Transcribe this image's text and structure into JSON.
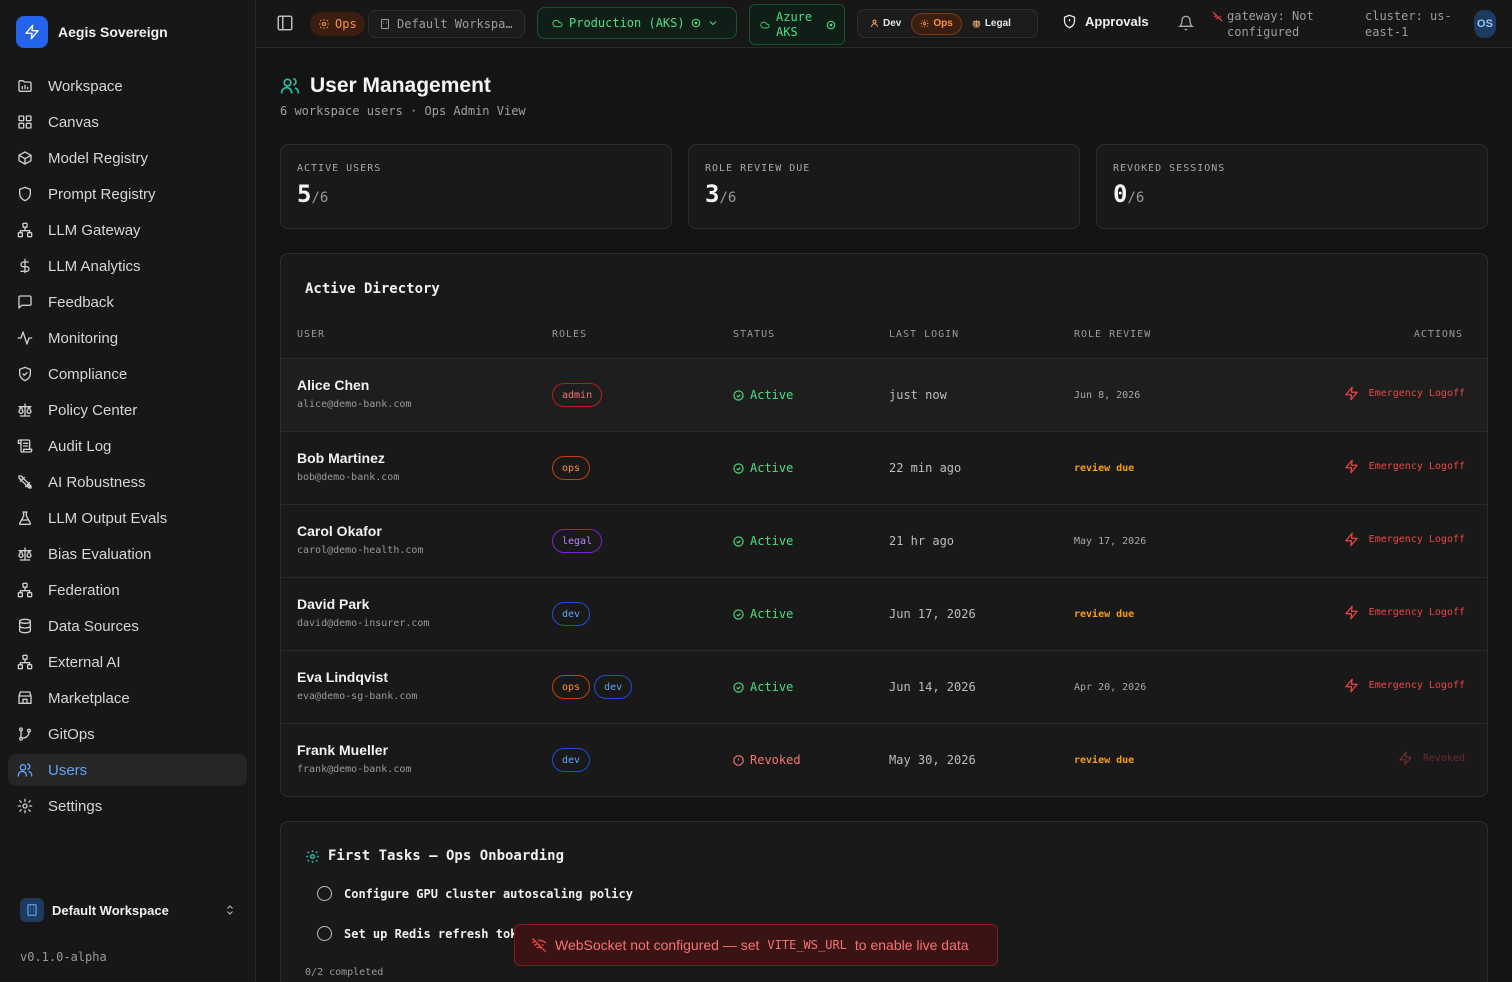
{
  "app": {
    "name": "Aegis Sovereign",
    "version": "v0.1.0-alpha"
  },
  "sidebar": {
    "items": [
      {
        "label": "Workspace",
        "icon": "folder-icon"
      },
      {
        "label": "Canvas",
        "icon": "grid-icon"
      },
      {
        "label": "Model Registry",
        "icon": "box-icon"
      },
      {
        "label": "Prompt Registry",
        "icon": "shield-icon"
      },
      {
        "label": "LLM Gateway",
        "icon": "network-icon"
      },
      {
        "label": "LLM Analytics",
        "icon": "dollar-icon"
      },
      {
        "label": "Feedback",
        "icon": "message-icon"
      },
      {
        "label": "Monitoring",
        "icon": "activity-icon"
      },
      {
        "label": "Compliance",
        "icon": "shield-check-icon"
      },
      {
        "label": "Policy Center",
        "icon": "scale-icon"
      },
      {
        "label": "Audit Log",
        "icon": "scroll-icon"
      },
      {
        "label": "AI Robustness",
        "icon": "swords-icon"
      },
      {
        "label": "LLM Output Evals",
        "icon": "flask-icon"
      },
      {
        "label": "Bias Evaluation",
        "icon": "scale-icon"
      },
      {
        "label": "Federation",
        "icon": "network-icon"
      },
      {
        "label": "Data Sources",
        "icon": "database-icon"
      },
      {
        "label": "External AI",
        "icon": "network-icon"
      },
      {
        "label": "Marketplace",
        "icon": "store-icon"
      },
      {
        "label": "GitOps",
        "icon": "git-branch-icon"
      },
      {
        "label": "Users",
        "icon": "users-icon"
      },
      {
        "label": "Settings",
        "icon": "gear-icon"
      }
    ],
    "active_index": 19,
    "workspace_switcher": "Default Workspace"
  },
  "topbar": {
    "role_chip": "Ops",
    "workspace": "Default Workspa…",
    "environment": "Production (AKS)",
    "cloud_line1": "Azure",
    "cloud_line2": "AKS",
    "personas": [
      "Dev",
      "Ops",
      "Legal"
    ],
    "active_persona": "Ops",
    "approvals": "Approvals",
    "gateway_line1": "gateway: Not",
    "gateway_line2": "configured",
    "cluster_line1": "cluster: us-",
    "cluster_line2": "east-1",
    "avatar": "OS"
  },
  "page": {
    "title": "User Management",
    "subtitle": "6 workspace users · Ops Admin View"
  },
  "stats": [
    {
      "label": "ACTIVE USERS",
      "value": "5",
      "total": "/6"
    },
    {
      "label": "ROLE REVIEW DUE",
      "value": "3",
      "total": "/6"
    },
    {
      "label": "REVOKED SESSIONS",
      "value": "0",
      "total": "/6"
    }
  ],
  "directory": {
    "title": "Active Directory",
    "columns": [
      "USER",
      "ROLES",
      "STATUS",
      "LAST LOGIN",
      "ROLE REVIEW",
      "ACTIONS"
    ],
    "rows": [
      {
        "name": "Alice Chen",
        "email": "alice@demo-bank.com",
        "roles": [
          "admin"
        ],
        "status": "Active",
        "last_login": "just now",
        "review": "Jun 8, 2026",
        "action": "Emergency Logoff"
      },
      {
        "name": "Bob Martinez",
        "email": "bob@demo-bank.com",
        "roles": [
          "ops"
        ],
        "status": "Active",
        "last_login": "22 min ago",
        "review": "review due",
        "action": "Emergency Logoff"
      },
      {
        "name": "Carol Okafor",
        "email": "carol@demo-health.com",
        "roles": [
          "legal"
        ],
        "status": "Active",
        "last_login": "21 hr ago",
        "review": "May 17, 2026",
        "action": "Emergency Logoff"
      },
      {
        "name": "David Park",
        "email": "david@demo-insurer.com",
        "roles": [
          "dev"
        ],
        "status": "Active",
        "last_login": "Jun 17, 2026",
        "review": "review due",
        "action": "Emergency Logoff"
      },
      {
        "name": "Eva Lindqvist",
        "email": "eva@demo-sg-bank.com",
        "roles": [
          "ops",
          "dev"
        ],
        "status": "Active",
        "last_login": "Jun 14, 2026",
        "review": "Apr 20, 2026",
        "action": "Emergency Logoff"
      },
      {
        "name": "Frank Mueller",
        "email": "frank@demo-bank.com",
        "roles": [
          "dev"
        ],
        "status": "Revoked",
        "last_login": "May 30, 2026",
        "review": "review due",
        "action": "Revoked"
      }
    ]
  },
  "tasks": {
    "title": "First Tasks — Ops Onboarding",
    "items": [
      "Configure GPU cluster autoscaling policy",
      "Set up Redis refresh token rotation"
    ],
    "progress": "0/2 completed"
  },
  "toast": {
    "prefix": "WebSocket not configured — set",
    "code": "VITE_WS_URL",
    "suffix": "to enable live data"
  },
  "colors": {
    "accent": "#3b82f6",
    "ops": "#fb923c",
    "ok": "#4ade80",
    "danger": "#ef4444",
    "warn": "#f59e0b"
  }
}
